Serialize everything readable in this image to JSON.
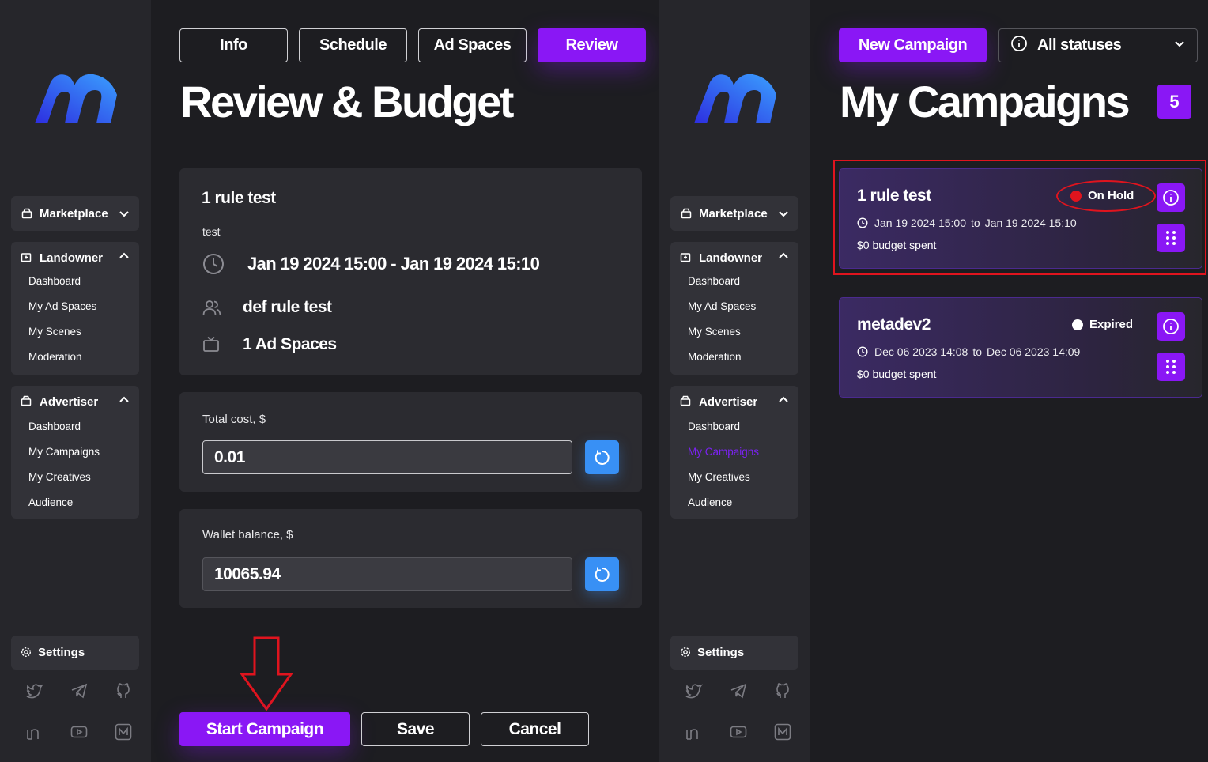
{
  "colors": {
    "accent": "#8a17f5",
    "refresh": "#3890f5",
    "on_hold": "#e0141e",
    "expired": "#ffffff",
    "highlight": "#e0141e"
  },
  "sidebar": {
    "logo_icon": "m-logo",
    "marketplace": "Marketplace",
    "landowner": {
      "label": "Landowner",
      "items": [
        "Dashboard",
        "My Ad Spaces",
        "My Scenes",
        "Moderation"
      ]
    },
    "advertiser": {
      "label": "Advertiser",
      "items": [
        "Dashboard",
        "My Campaigns",
        "My Creatives",
        "Audience"
      ]
    },
    "settings": "Settings",
    "socials": [
      "twitter-icon",
      "telegram-icon",
      "github-icon",
      "linkedin-icon",
      "youtube-icon",
      "medium-icon"
    ]
  },
  "editor": {
    "tabs": [
      "Info",
      "Schedule",
      "Ad Spaces",
      "Review"
    ],
    "active_tab": "Review",
    "title": "Review & Budget",
    "summary": {
      "name": "1 rule test",
      "description": "test",
      "date_range": "Jan 19 2024 15:00 - Jan 19 2024 15:10",
      "audience": "def rule test",
      "ad_spaces": "1 Ad Spaces"
    },
    "total_cost": {
      "label": "Total cost, $",
      "value": "0.01"
    },
    "wallet": {
      "label": "Wallet balance, $",
      "value": "10065.94"
    },
    "buttons": {
      "start": "Start Campaign",
      "save": "Save",
      "cancel": "Cancel"
    }
  },
  "campaigns": {
    "new_button": "New Campaign",
    "status_filter": "All statuses",
    "title": "My Campaigns",
    "count": "5",
    "items": [
      {
        "name": "1 rule test",
        "status": "On Hold",
        "start": "Jan 19 2024 15:00",
        "to": "to",
        "end": "Jan 19 2024 15:10",
        "budget": "$0 budget spent"
      },
      {
        "name": "metadev2",
        "status": "Expired",
        "start": "Dec 06 2023 14:08",
        "to": "to",
        "end": "Dec 06 2023 14:09",
        "budget": "$0 budget spent"
      }
    ]
  }
}
